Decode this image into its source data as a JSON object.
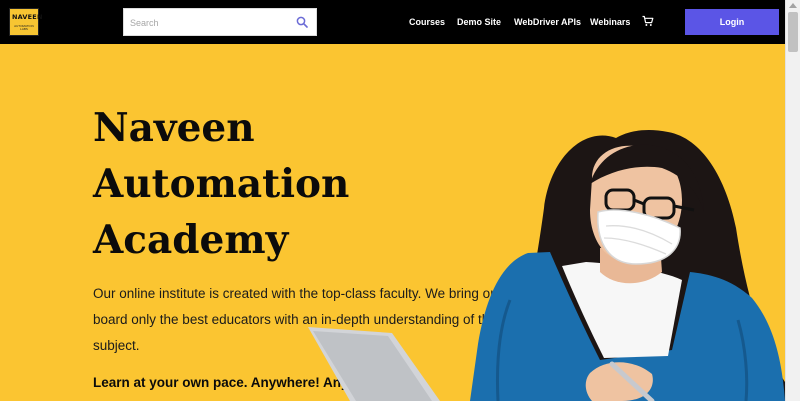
{
  "header": {
    "logo": {
      "line1": "NAVEEN",
      "line2": "AUTOMATION LABS"
    },
    "search": {
      "placeholder": "Search",
      "icon": "search-icon"
    },
    "nav": [
      {
        "label": "Courses"
      },
      {
        "label": "Demo Site"
      },
      {
        "label": "WebDriver APIs"
      },
      {
        "label": "Webinars"
      }
    ],
    "cart_icon": "cart-icon",
    "login_label": "Login"
  },
  "hero": {
    "title_lines": [
      "Naveen",
      "Automation",
      "Academy"
    ],
    "description": "Our online institute is created with the top-class faculty. We bring on board only the best educators with an in-depth understanding of the subject.",
    "tagline": "Learn at your own pace. Anywhere! Anytime!"
  },
  "colors": {
    "header_bg": "#000000",
    "hero_bg": "#fbc531",
    "login_button": "#5b55e6",
    "search_icon": "#6b6bd6"
  }
}
